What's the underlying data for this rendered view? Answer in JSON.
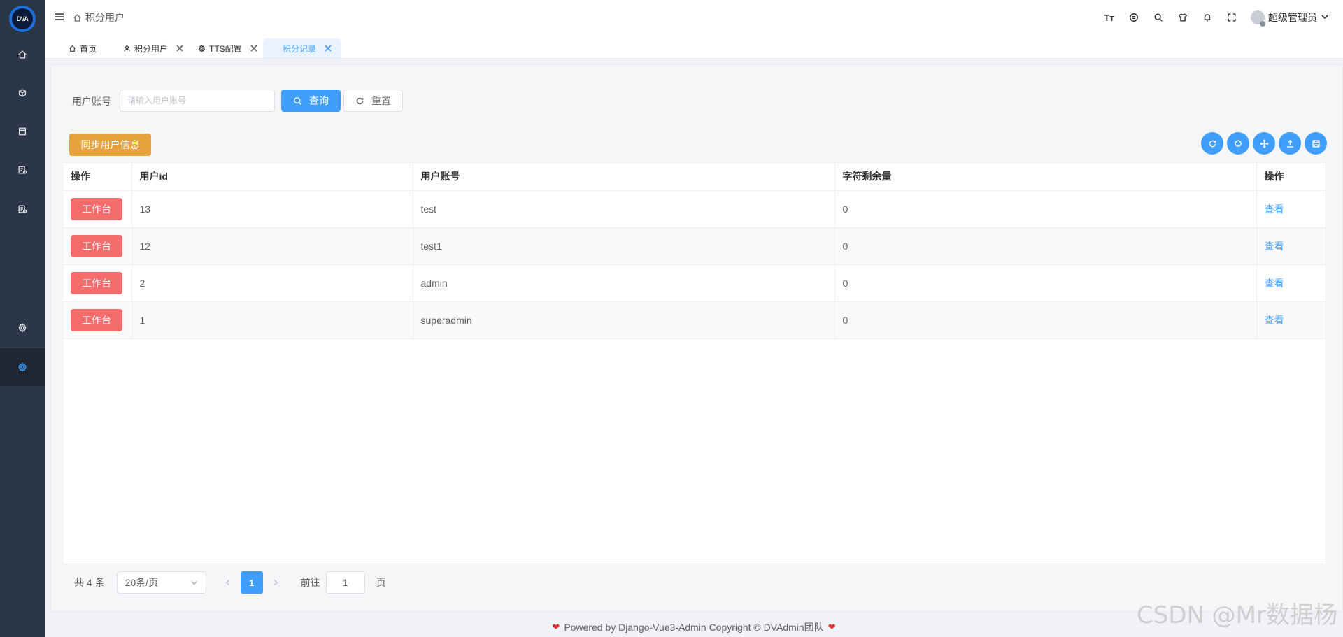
{
  "logo": {
    "text": "DVA"
  },
  "breadcrumb": {
    "current": "积分用户"
  },
  "header": {
    "font_size_icon": "Tт",
    "user_name": "超级管理员"
  },
  "tabs": [
    {
      "label": "首页"
    },
    {
      "label": "积分用户"
    },
    {
      "label": "TTS配置"
    },
    {
      "label": "积分记录"
    }
  ],
  "search": {
    "label": "用户账号",
    "placeholder": "请输入用户账号",
    "query_label": "查询",
    "reset_label": "重置"
  },
  "toolbar": {
    "sync_label": "同步用户信息"
  },
  "table": {
    "columns": [
      "操作",
      "用户id",
      "用户账号",
      "字符剩余量",
      "操作"
    ],
    "action_button": "工作台",
    "view_link": "查看",
    "rows": [
      {
        "id": "13",
        "account": "test",
        "remaining": "0"
      },
      {
        "id": "12",
        "account": "test1",
        "remaining": "0"
      },
      {
        "id": "2",
        "account": "admin",
        "remaining": "0"
      },
      {
        "id": "1",
        "account": "superadmin",
        "remaining": "0"
      }
    ]
  },
  "pagination": {
    "total": "共 4 条",
    "page_size": "20条/页",
    "current_page": "1",
    "goto_label": "前往",
    "goto_value": "1",
    "page_suffix": "页"
  },
  "footer": {
    "text": "Powered by Django-Vue3-Admin Copyright © DVAdmin团队"
  },
  "watermark": "CSDN @Mr数据杨",
  "colors": {
    "sidebar": "#2b3646",
    "primary": "#409eff",
    "warning": "#e6a23c",
    "danger": "#f56c6c"
  }
}
